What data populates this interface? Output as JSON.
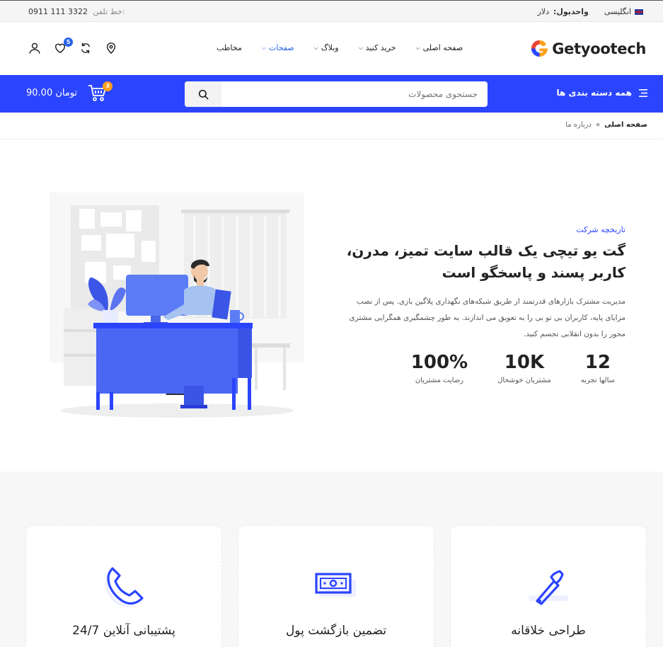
{
  "topbar": {
    "phone_label": "خط تلفن:",
    "phone_number": "0911 111 3322",
    "currency_label": "واحدپول:",
    "currency_value": "دلار",
    "language": "انگلیسی"
  },
  "header": {
    "logo_text": "Getyootech",
    "nav": [
      {
        "label": "صفحه اصلی",
        "dropdown": true
      },
      {
        "label": "خرید کنید",
        "dropdown": true
      },
      {
        "label": "وبلاگ",
        "dropdown": true
      },
      {
        "label": "صفحات",
        "dropdown": true,
        "active": true
      },
      {
        "label": "مخاطب",
        "dropdown": false
      }
    ],
    "wishlist_count": "5"
  },
  "bluebar": {
    "categories_label": "همه دسته بندی ها",
    "search_placeholder": "جستجوی محصولات",
    "cart_amount": "90.00 تومان",
    "cart_count": "3"
  },
  "breadcrumb": {
    "home": "صفحه اصلی",
    "current": "درباره ما"
  },
  "about": {
    "kicker": "تاریخچه شرکت",
    "headline": "گت یو تیچی یک قالب سایت تمیز، مدرن، کاربر پسند و پاسخگو است",
    "body": "مدیریت مشترک بازارهای قدرتمند از طریق شبکه‌های نگهداری پلاگین بازی. پس از نصب مزایای پایه، کاربران بی تو بی را به تعویق می اندازند. به طور چشمگیری همگرایی مشتری محور را بدون انقلابی تجسم کنید.",
    "stats": [
      {
        "value": "12",
        "label": "سالها تجربه"
      },
      {
        "value": "10K",
        "label": "مشتریان خوشحال"
      },
      {
        "value": "100%",
        "label": "رضایت مشتریان"
      }
    ]
  },
  "features": [
    {
      "title": "طراحی خلاقانه",
      "icon": "brush-icon"
    },
    {
      "title": "تضمین بازگشت پول",
      "icon": "money-icon"
    },
    {
      "title": "پشتیبانی آنلاین 24/7",
      "icon": "phone-icon"
    }
  ],
  "colors": {
    "brand_blue": "#2b45ff",
    "accent_orange": "#ff9f1c",
    "link_blue": "#2563eb"
  }
}
